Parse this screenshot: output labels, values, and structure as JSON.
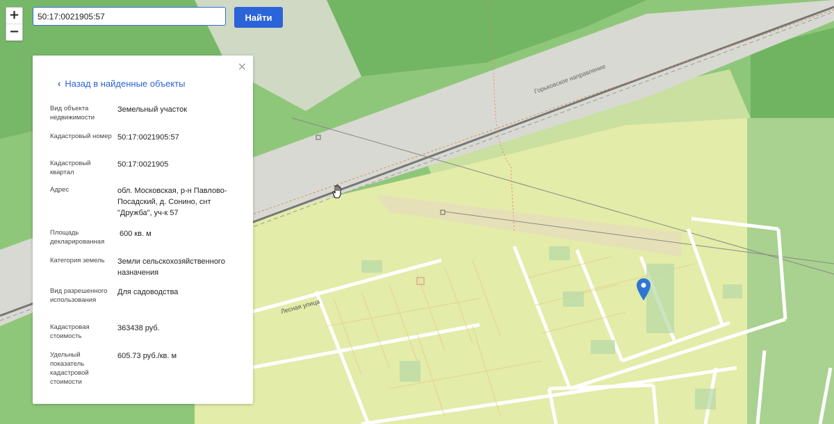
{
  "colors": {
    "accent": "#2b63d9",
    "forest": "#8fc77a",
    "forest_dark": "#6fb662",
    "gardens": "#dfeaa5",
    "railway_zone": "#d6d6d0",
    "road": "#ffffff"
  },
  "map": {
    "street_label": "Лесная улица",
    "rail_label": "Горьковское направление"
  },
  "controls": {
    "zoom_in": "+",
    "zoom_out": "−"
  },
  "search": {
    "value": "50:17:0021905:57",
    "button_label": "Найти"
  },
  "panel": {
    "close_icon": "×",
    "back_chevron": "‹",
    "back_label": "Назад в найденные объекты",
    "fields": [
      {
        "label": "Вид объекта недвижимости",
        "value": "Земельный участок"
      },
      {
        "label": "Кадастровый номер",
        "value": "50:17:0021905:57"
      },
      {
        "label": "Кадастровый квартал",
        "value": "50:17:0021905"
      },
      {
        "label": "Адрес",
        "value": "обл. Московская, р-н Павлово-Посадский, д. Сонино, снт \"Дружба\", уч-к 57"
      },
      {
        "label": "Площадь декларированная",
        "value": "600 кв. м"
      },
      {
        "label": "Категория земель",
        "value": "Земли сельскохозяйственного назначения"
      },
      {
        "label": "Вид разрешенного использования",
        "value": "Для садоводства"
      },
      {
        "label": "Кадастровая стоимость",
        "value": "363438 руб."
      },
      {
        "label": "Удельный показатель кадастровой стоимости",
        "value": "605.73 руб./кв. м"
      }
    ]
  }
}
